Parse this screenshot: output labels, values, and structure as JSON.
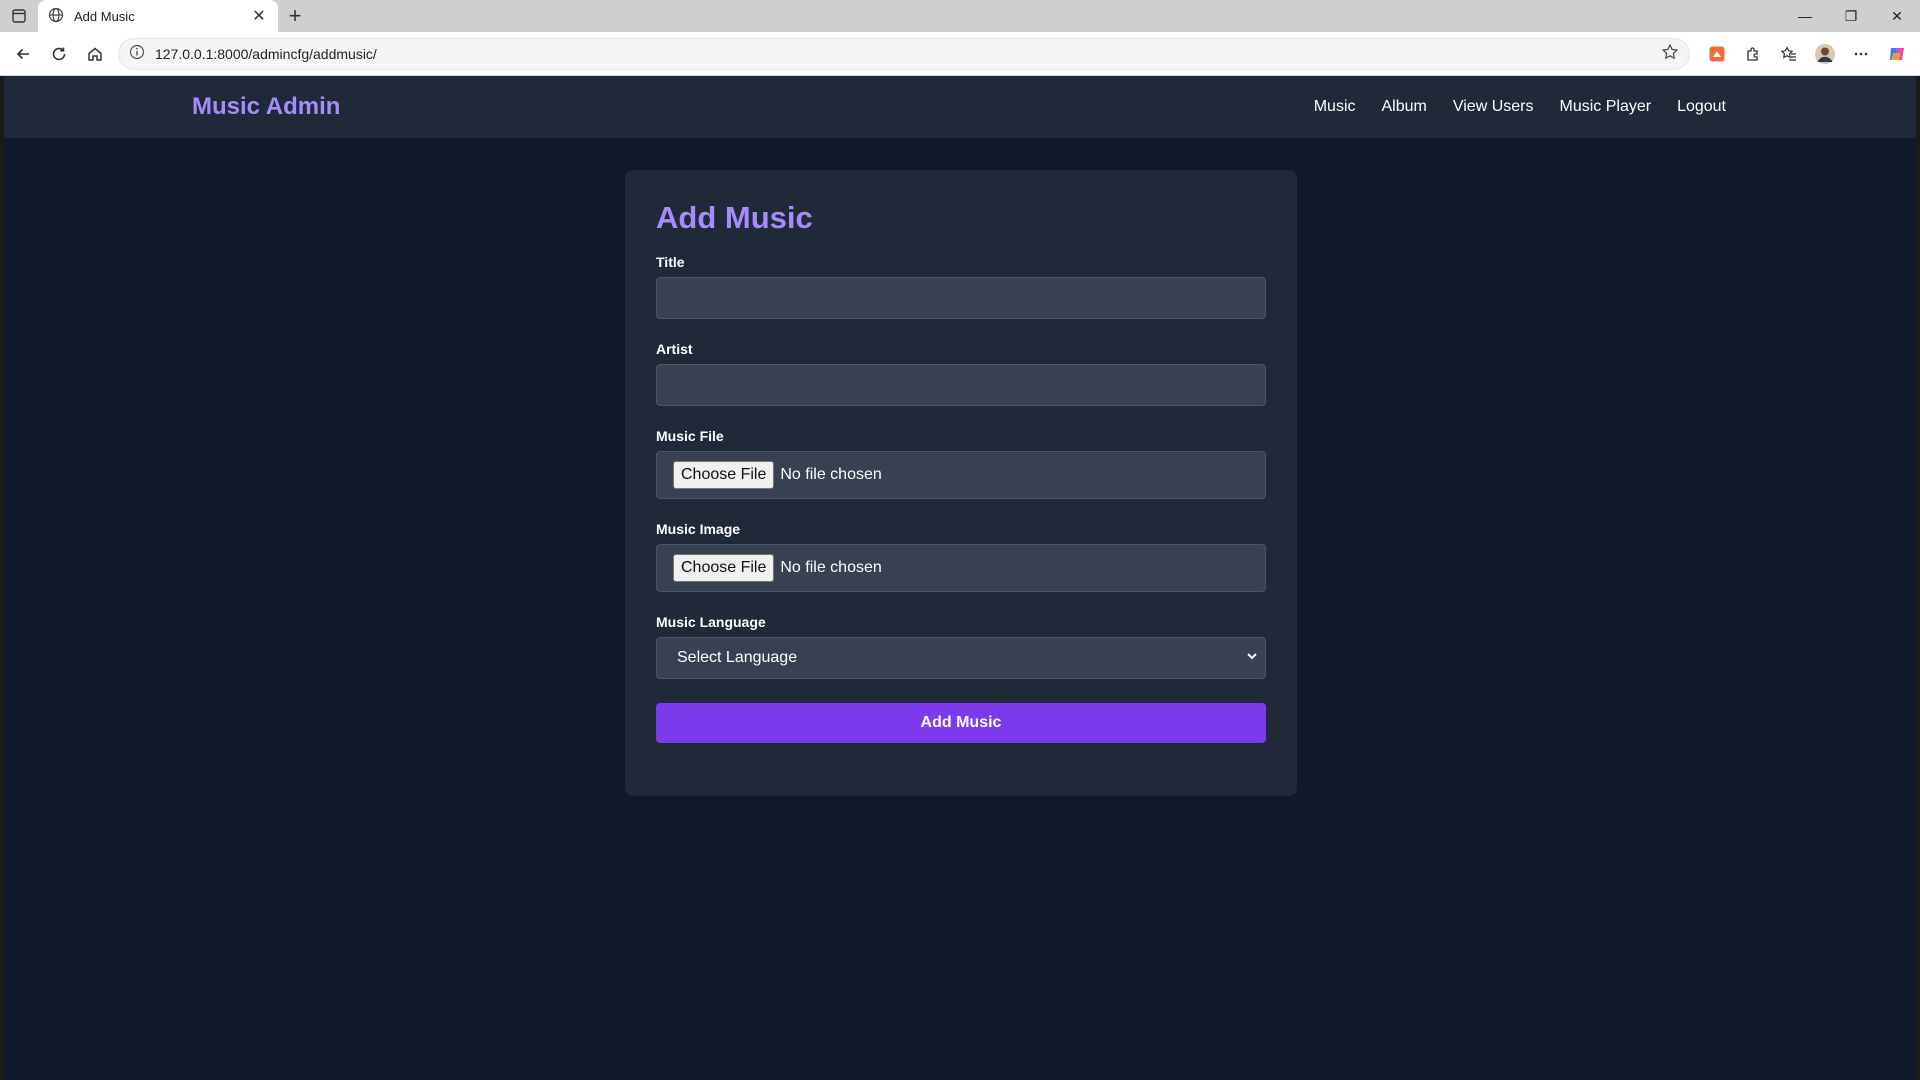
{
  "browser": {
    "tab_title": "Add Music",
    "url": "127.0.0.1:8000/admincfg/addmusic/"
  },
  "nav": {
    "brand": "Music Admin",
    "links": [
      "Music",
      "Album",
      "View Users",
      "Music Player",
      "Logout"
    ]
  },
  "form": {
    "heading": "Add Music",
    "title_label": "Title",
    "title_value": "",
    "artist_label": "Artist",
    "artist_value": "",
    "music_file_label": "Music File",
    "music_file_button": "Choose File",
    "music_file_status": "No file chosen",
    "music_image_label": "Music Image",
    "music_image_button": "Choose File",
    "music_image_status": "No file chosen",
    "language_label": "Music Language",
    "language_selected": "Select Language",
    "submit_label": "Add Music"
  },
  "colors": {
    "accent": "#a78bfa",
    "button": "#7c3aed",
    "page_bg": "#111827",
    "card_bg": "#1f2937",
    "input_bg": "#374151"
  }
}
